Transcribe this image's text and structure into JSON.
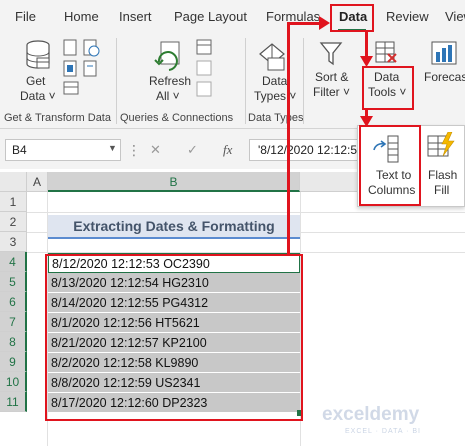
{
  "tabs": [
    "File",
    "Home",
    "Insert",
    "Page Layout",
    "Formulas",
    "Data",
    "Review",
    "View"
  ],
  "active_tab": "Data",
  "ribbon": {
    "get_data_line1": "Get",
    "get_data_line2": "Data ˅",
    "refresh_line1": "Refresh",
    "refresh_line2": "All ˅",
    "data_types_line1": "Data",
    "data_types_line2": "Types ˅",
    "sort_filter_line1": "Sort &",
    "sort_filter_line2": "Filter ˅",
    "data_tools_line1": "Data",
    "data_tools_line2": "Tools ˅",
    "forecast_label": "Forecast",
    "groups": [
      "Get & Transform Data",
      "Queries & Connections",
      "Data Types"
    ]
  },
  "popup": {
    "text_to_columns_line1": "Text to",
    "text_to_columns_line2": "Columns",
    "flash_fill_line1": "Flash",
    "flash_fill_line2": "Fill"
  },
  "formula_bar": {
    "name_box": "B4",
    "cancel": "✕",
    "enter": "✓",
    "fx": "fx",
    "formula": "'8/12/2020 12:12:53 OC2390"
  },
  "columns": [
    "A",
    "B"
  ],
  "rows": [
    "1",
    "2",
    "3",
    "4",
    "5",
    "6",
    "7",
    "8",
    "9",
    "10",
    "11"
  ],
  "sheet_title": "Extracting Dates & Formatting",
  "records": [
    "8/12/2020 12:12:53 OC2390",
    "8/13/2020 12:12:54 HG2310",
    "8/14/2020 12:12:55 PG4312",
    "8/1/2020 12:12:56 HT5621",
    "8/21/2020 12:12:57 KP2100",
    "8/2/2020 12:12:58 KL9890",
    "8/8/2020 12:12:59 US2341",
    "8/17/2020 12:12:60 DP2323"
  ],
  "watermark": "exceldemy",
  "watermark_sub": "EXCEL · DATA · BI"
}
